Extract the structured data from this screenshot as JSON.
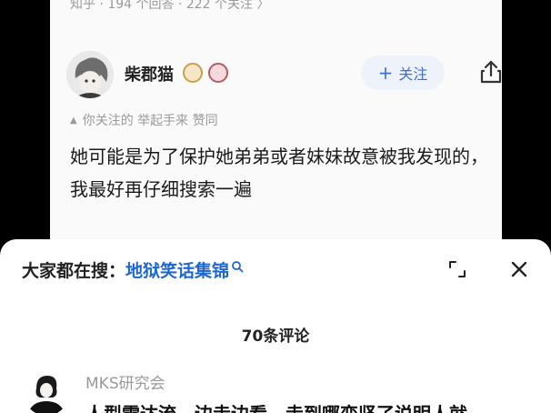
{
  "answer_card": {
    "meta": "知乎 · 194 个回答 · 222 个关注 〉",
    "author": {
      "name": "柴郡猫",
      "follow_label": "关注",
      "follow_plus": "+"
    },
    "endorsement": {
      "marker": "▲",
      "text": "你关注的 举起手来 赞同"
    },
    "content": "她可能是为了保护她弟弟或者妹妹故意被我发现的，我最好再仔细搜索一遍"
  },
  "sheet": {
    "search_prefix": "大家都在搜：",
    "search_term": "地狱笑话集锦",
    "comments_count": "70条评论",
    "comment": {
      "username": "MKS研究会",
      "text": "人型雷达流，边走边看，走到哪变坚了说明人就"
    }
  },
  "icons": {
    "share": "share-icon",
    "expand": "expand-icon",
    "close": "close-icon",
    "search": "search-icon"
  },
  "colors": {
    "accent_blue": "#1e66d6",
    "follow_bg": "#eef3fb",
    "follow_text": "#3f6fd1"
  }
}
